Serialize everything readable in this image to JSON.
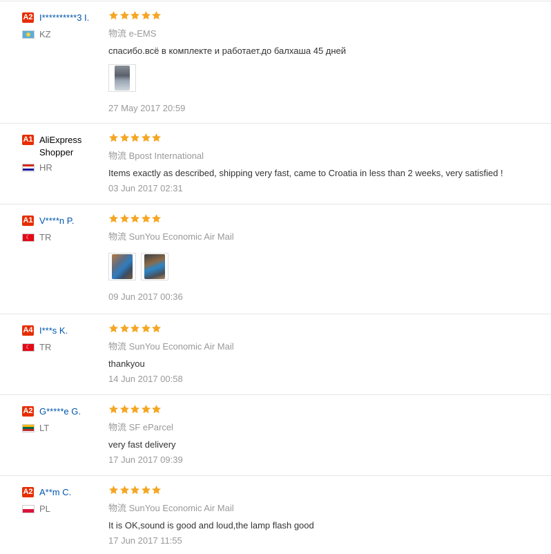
{
  "star_color": "#f5a623",
  "reviews": [
    {
      "level": "A2",
      "name": "I**********3 I.",
      "country": "KZ",
      "logistics_prefix": "物流",
      "logistics": "e-EMS",
      "comment": "спасибо.всё в комплекте и работает.до балхаша 45 дней",
      "date": "27 May 2017 20:59"
    },
    {
      "level": "A1",
      "name": "AliExpress Shopper",
      "country": "HR",
      "logistics_prefix": "物流",
      "logistics": "Bpost International",
      "comment": "Items exactly as described, shipping very fast, came to Croatia in less than 2 weeks, very satisfied !",
      "date": "03 Jun 2017 02:31"
    },
    {
      "level": "A1",
      "name": "V****n P.",
      "country": "TR",
      "logistics_prefix": "物流",
      "logistics": "SunYou Economic Air Mail",
      "comment": "",
      "date": "09 Jun 2017 00:36"
    },
    {
      "level": "A4",
      "name": "I***s K.",
      "country": "TR",
      "logistics_prefix": "物流",
      "logistics": "SunYou Economic Air Mail",
      "comment": "thankyou",
      "date": "14 Jun 2017 00:58"
    },
    {
      "level": "A2",
      "name": "G*****e G.",
      "country": "LT",
      "logistics_prefix": "物流",
      "logistics": "SF eParcel",
      "comment": "very fast delivery",
      "date": "17 Jun 2017 09:39"
    },
    {
      "level": "A2",
      "name": "A**m C.",
      "country": "PL",
      "logistics_prefix": "物流",
      "logistics": "SunYou Economic Air Mail",
      "comment": "It is OK,sound is good and loud,the lamp flash good",
      "date": "17 Jun 2017 11:55"
    }
  ]
}
